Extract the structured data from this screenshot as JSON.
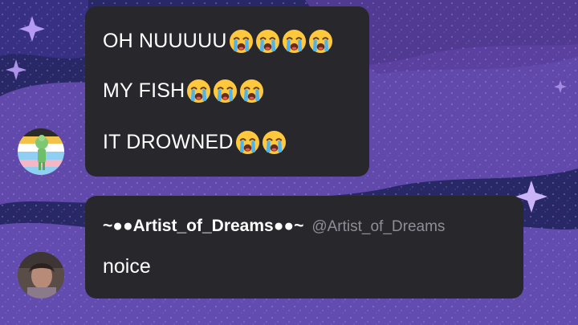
{
  "messages": [
    {
      "lines": [
        {
          "text": "OH NUUUUU",
          "emoji_count": 4
        },
        {
          "text": "MY FISH",
          "emoji_count": 3
        },
        {
          "text": "IT DROWNED",
          "emoji_count": 2
        }
      ],
      "avatar_icon": "flag-character-avatar"
    },
    {
      "display_name": "~●●Artist_of_Dreams●●~",
      "handle": "@Artist_of_Dreams",
      "text": "noice",
      "avatar_icon": "user-photo-avatar"
    }
  ],
  "emoji": "loudly-crying-face",
  "colors": {
    "bubble": "#28272b",
    "background_dark": "#2a2a6e",
    "background_purple": "#7a5bc0",
    "handle_gray": "#8e8e98",
    "text": "#ffffff"
  }
}
